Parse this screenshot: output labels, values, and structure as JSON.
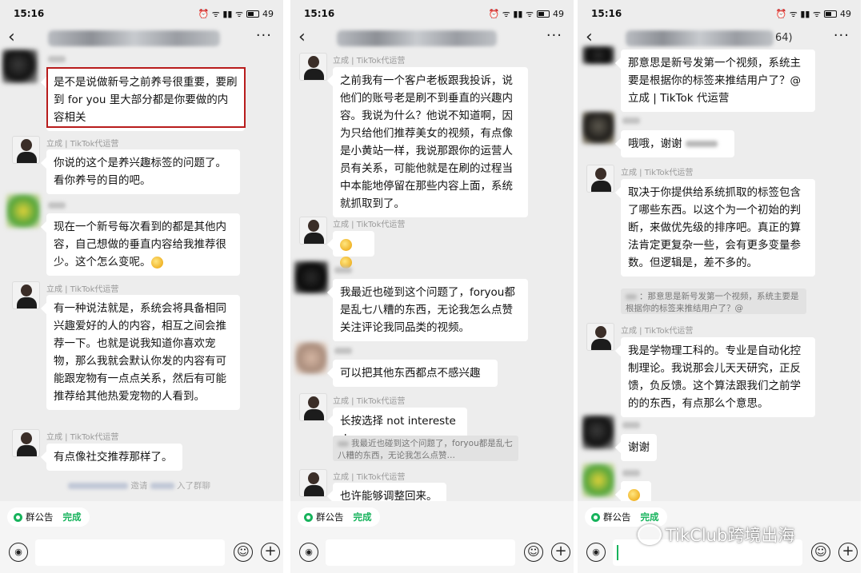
{
  "status_bar": {
    "time": "15:16",
    "icons": "⏰ ᯤ ▮▮ ᯤ",
    "battery": "49"
  },
  "panels": [
    {
      "messages": [
        {
          "type": "in",
          "sender": "",
          "text": "是不是说做新号之前养号很重要，要刷到 for you 里大部分都是你要做的内容相关",
          "highlighted": true
        },
        {
          "type": "in",
          "sender": "立成 | TikTok代运营",
          "text": "你说的这个是养兴趣标签的问题了。看你养号的目的吧。"
        },
        {
          "type": "in",
          "sender": "",
          "text": "现在一个新号每次看到的都是其他内容，自己想做的垂直内容给我推荐很少。这个怎么变呢。"
        },
        {
          "type": "in",
          "sender": "立成 | TikTok代运营",
          "text": "有一种说法就是，系统会将具备相同兴趣爱好的人的内容，相互之间会推荐一下。也就是说我知道你喜欢宠物，那么我就会默认你发的内容有可能跟宠物有一点点关系，然后有可能推荐给其他热爱宠物的人看到。"
        },
        {
          "type": "in",
          "sender": "立成 | TikTok代运营",
          "text": "有点像社交推荐那样了。"
        }
      ],
      "system_note": {
        "prefix": "邀请",
        "suffix": "入了群聊"
      }
    },
    {
      "messages": [
        {
          "type": "in",
          "sender": "立成 | TikTok代运营",
          "text": "之前我有一个客户老板跟我投诉，说他们的账号老是刷不到垂直的兴趣内容。我说为什么？他说不知道啊，因为只给他们推荐美女的视频，有点像是小黄站一样，我说那跟你的运营人员有关系，可能他就是在刷的过程当中本能地停留在那些内容上面，系统就抓取到了。"
        },
        {
          "type": "in",
          "sender": "立成 | TikTok代运营",
          "text": ""
        },
        {
          "type": "in",
          "sender": "",
          "text": "我最近也碰到这个问题了，foryou都是乱七八糟的东西，无论我怎么点赞关注评论我同品类的视频。"
        },
        {
          "type": "in",
          "sender": "",
          "text": "可以把其他东西都点不感兴趣"
        },
        {
          "type": "in",
          "sender": "立成 | TikTok代运营",
          "text": "长按选择 not interested",
          "quote": "我最近也碰到这个问题了，foryou都是乱七八糟的东西，无论我怎么点赞…"
        },
        {
          "type": "in",
          "sender": "立成 | TikTok代运营",
          "text": "也许能够调整回来。"
        }
      ]
    },
    {
      "title_count": "64)",
      "messages": [
        {
          "type": "in",
          "sender": "",
          "text": "那意思是新号发第一个视频，系统主要是根据你的标签来推结用户了？@立成 | TikTok 代运营"
        },
        {
          "type": "in",
          "sender": "",
          "text": "哦哦，谢谢"
        },
        {
          "type": "in",
          "sender": "立成 | TikTok代运营",
          "text": "取决于你提供给系统抓取的标签包含了哪些东西。以这个为一个初始的判断，来做优先级的排序吧。真正的算法肯定更复杂一些，会有更多变量参数。但逻辑是，差不多的。",
          "quote": "：那意思是新号发第一个视频，系统主要是根据你的标签来推结用户了？@"
        },
        {
          "type": "in",
          "sender": "立成 | TikTok代运营",
          "text": "我是学物理工科的。专业是自动化控制理论。我说那会儿天天研究，正反馈，负反馈。这个算法跟我们之前学的的东西，有点那么个意思。"
        },
        {
          "type": "in",
          "sender": "",
          "text": "谢谢"
        },
        {
          "type": "in",
          "sender": "",
          "text": ""
        }
      ]
    }
  ],
  "bottom": {
    "notice_label": "群公告",
    "notice_status": "完成"
  },
  "watermark": "TikClub跨境出海",
  "colors": {
    "accent_green": "#17b35c",
    "highlight_red": "#b81c1c",
    "chat_bg": "#ededed"
  }
}
